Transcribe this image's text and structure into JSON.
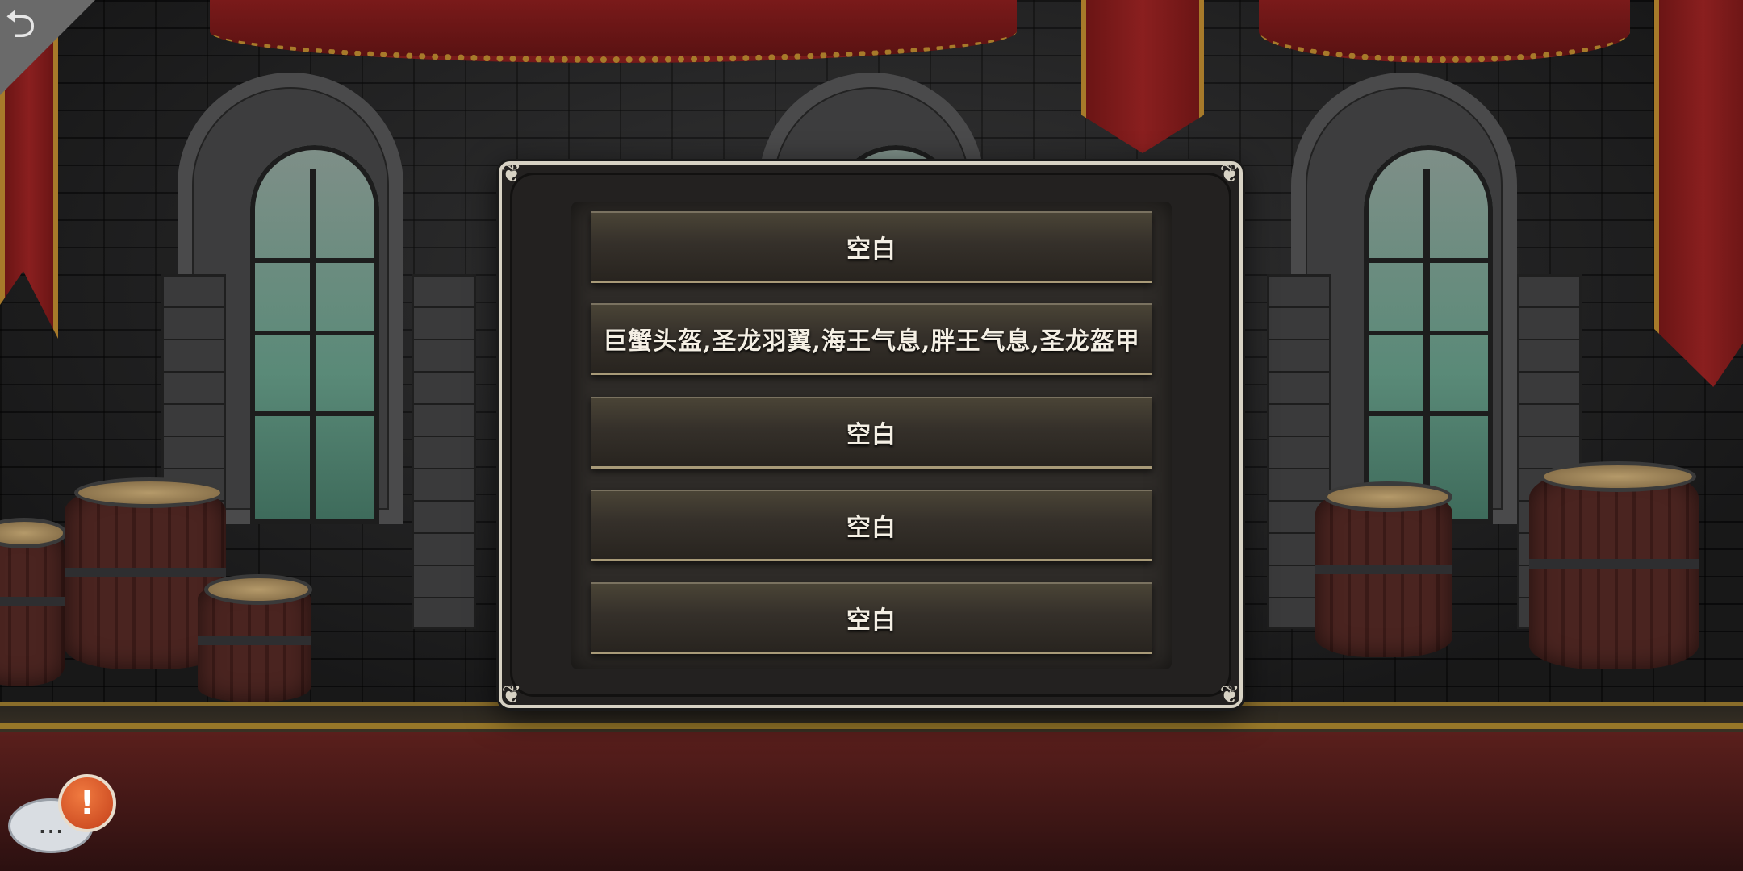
{
  "slots": [
    {
      "label": "空白"
    },
    {
      "label": "巨蟹头盔,圣龙羽翼,海王气息,胖王气息,圣龙盔甲"
    },
    {
      "label": "空白"
    },
    {
      "label": "空白"
    },
    {
      "label": "空白"
    }
  ],
  "icons": {
    "back": "back-arrow-icon",
    "chat": "chat-bubble-icon",
    "alert": "exclamation-icon"
  },
  "colors": {
    "dialog_border": "#d7d2c4",
    "dialog_bg": "#232120",
    "slot_text": "#f4efe4",
    "alert": "#d9541f"
  }
}
